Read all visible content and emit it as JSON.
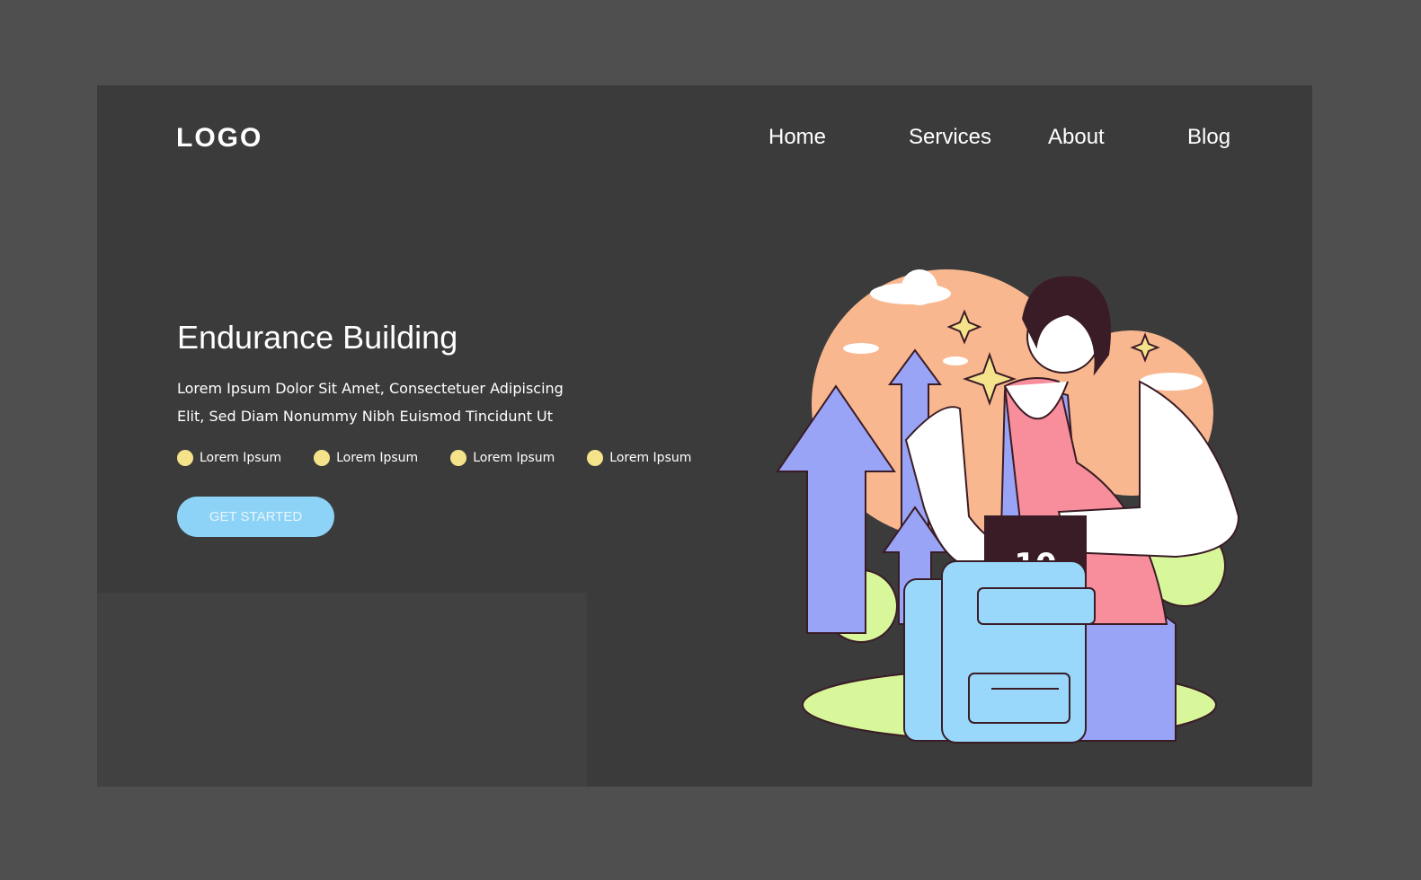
{
  "header": {
    "logo": "LOGO",
    "nav": [
      "Home",
      "Services",
      "About",
      "Blog"
    ]
  },
  "hero": {
    "title": "Endurance Building",
    "description": [
      "Lorem Ipsum Dolor Sit Amet, Consectetuer Adipiscing",
      "Elit, Sed Diam Nonummy Nibh Euismod Tincidunt Ut"
    ],
    "bullets": [
      "Lorem Ipsum",
      "Lorem Ipsum",
      "Lorem Ipsum",
      "Lorem Ipsum"
    ],
    "cta_label": "GET STARTED"
  },
  "illustration": {
    "weight_label": "10"
  },
  "colors": {
    "page_bg": "#4f4f4f",
    "panel_bg": "#414141",
    "accent": "#8dd3f7",
    "bullet": "#f5e38c",
    "arrow": "#9aa4f7",
    "sun": "#f8b78f",
    "shirt": "#f88e9b",
    "bag": "#99d8fa",
    "grass": "#d8f79a"
  }
}
